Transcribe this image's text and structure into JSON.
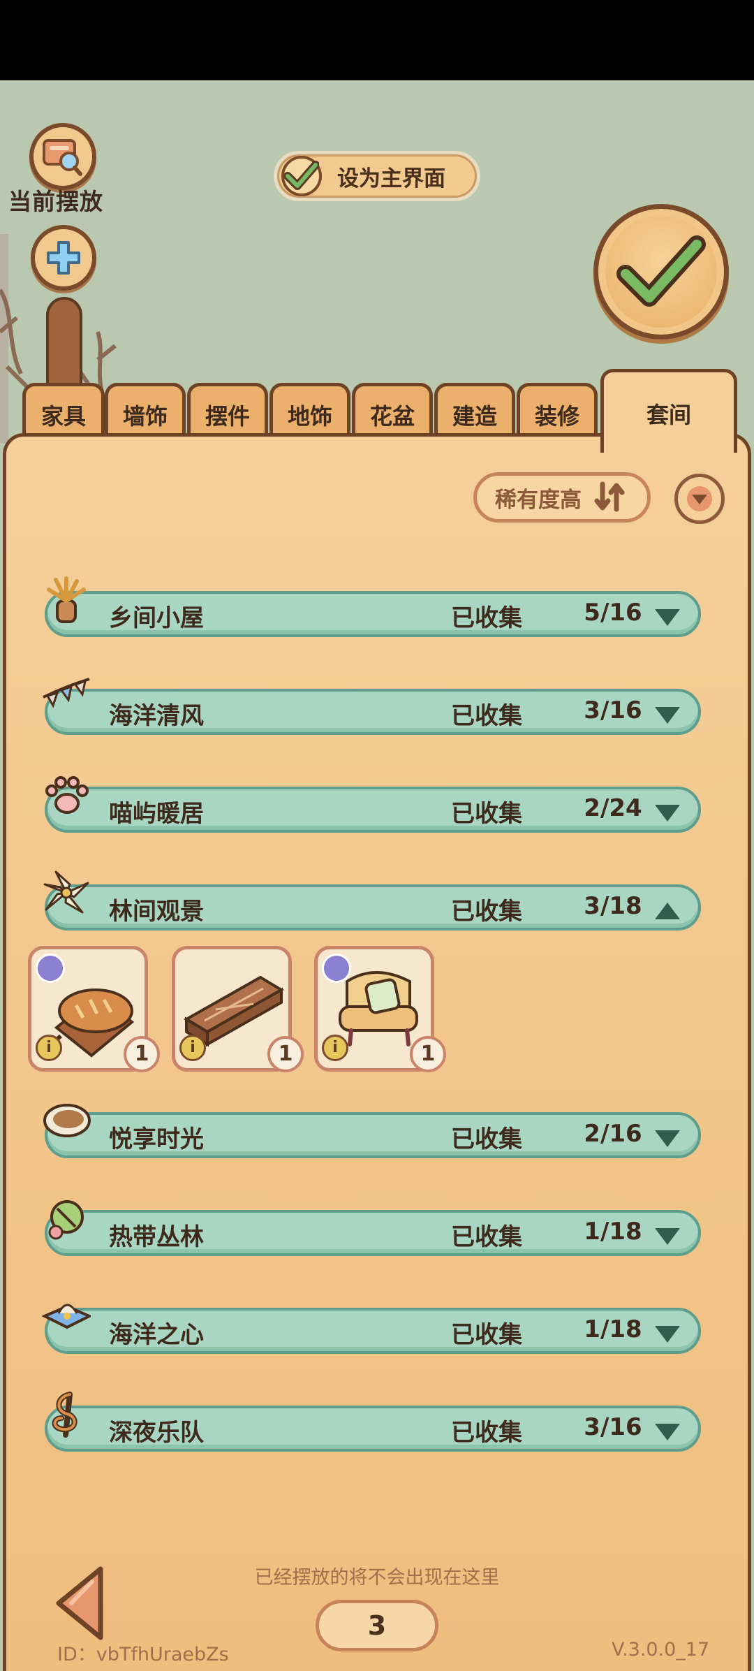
{
  "top_left": {
    "current_placement_label": "当前摆放",
    "current_placement_icon": "map-search-icon",
    "add_icon": "plus-icon"
  },
  "main_toggle": {
    "label": "设为主界面",
    "checked": true
  },
  "confirm_icon": "check-icon",
  "tabs": [
    {
      "label": "家具"
    },
    {
      "label": "墙饰"
    },
    {
      "label": "摆件"
    },
    {
      "label": "地饰"
    },
    {
      "label": "花盆"
    },
    {
      "label": "建造"
    },
    {
      "label": "装修"
    },
    {
      "label": "套间",
      "active": true
    }
  ],
  "sort": {
    "label": "稀有度高",
    "icon": "sort-arrows-icon",
    "dropdown_icon": "chevron-down-icon"
  },
  "suites": [
    {
      "name": "乡间小屋",
      "collected_label": "已收集",
      "count": "5/16",
      "expanded": false,
      "icon": "wheat-vase-icon"
    },
    {
      "name": "海洋清风",
      "collected_label": "已收集",
      "count": "3/16",
      "expanded": false,
      "icon": "bunting-icon"
    },
    {
      "name": "喵屿暖居",
      "collected_label": "已收集",
      "count": "2/24",
      "expanded": false,
      "icon": "paw-icon"
    },
    {
      "name": "林间观景",
      "collected_label": "已收集",
      "count": "3/18",
      "expanded": true,
      "icon": "flower-icon"
    },
    {
      "name": "悦享时光",
      "collected_label": "已收集",
      "count": "2/16",
      "expanded": false,
      "icon": "pie-icon"
    },
    {
      "name": "热带丛林",
      "collected_label": "已收集",
      "count": "1/18",
      "expanded": false,
      "icon": "coconut-icon"
    },
    {
      "name": "海洋之心",
      "collected_label": "已收集",
      "count": "1/18",
      "expanded": false,
      "icon": "shell-cushion-icon"
    },
    {
      "name": "深夜乐队",
      "collected_label": "已收集",
      "count": "3/16",
      "expanded": false,
      "icon": "treble-clef-icon"
    }
  ],
  "expanded_items": [
    {
      "name": "bread-board-item",
      "qty": "1",
      "info": "i",
      "has_badge": true
    },
    {
      "name": "wooden-box-item",
      "qty": "1",
      "info": "i",
      "has_badge": false
    },
    {
      "name": "armchair-item",
      "qty": "1",
      "info": "i",
      "has_badge": true
    }
  ],
  "footer": {
    "hint": "已经摆放的将不会出现在这里",
    "page": "3",
    "id_text": "ID：vbTfhUraebZs",
    "version": "V.3.0.0_17"
  },
  "colors": {
    "panel": "#f5cf9a",
    "row": "#a9d6c2",
    "row_border": "#5f9d8c",
    "outline": "#6e4224",
    "check_green": "#6fa85e"
  }
}
